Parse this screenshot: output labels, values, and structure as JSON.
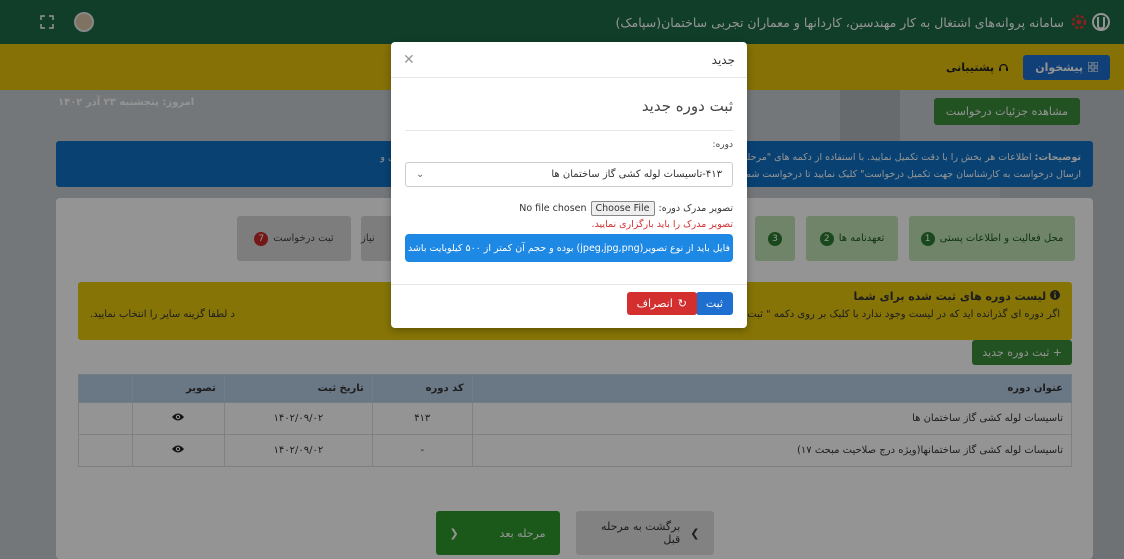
{
  "header": {
    "title": "سامانه پروانه‌های اشتغال به کار مهندسین، کاردانها و معماران تجربی ساختمان(سپامک)"
  },
  "navbar": {
    "dashboard": "پیشخوان",
    "support": "پشتیبانی"
  },
  "page": {
    "today": "امروز: پنجشنبه ۲۳ آذر ۱۴۰۲",
    "details_button": "مشاهده جزئیات درخواست",
    "info_bold": "توضیحات:",
    "info_line1": "اطلاعات هر بخش را با دقت تکمیل نمایید. با استفاده از دکمه های \"مرحله بعد\" که باید تمامی بخشها را تکمیل کرده و سپس در بخش پایانی بر روی دکمه \"ثبت نهایی و",
    "info_line2": "ارسال درخواست به کارشناسان جهت تکمیل درخواست\" کلیک نمایید تا درخواست شما به"
  },
  "steps": [
    {
      "num": "1",
      "label": "محل فعالیت و اطلاعات پستی",
      "state": "done"
    },
    {
      "num": "2",
      "label": "تعهدنامه ها",
      "state": "done"
    },
    {
      "num": "3",
      "label": "",
      "state": "done"
    },
    {
      "num": "",
      "label": "نیاز",
      "state": "pending"
    },
    {
      "num": "7",
      "label": "ثبت درخواست",
      "state": "pending"
    }
  ],
  "course_list": {
    "title": "لیست دوره های ثبت شده برای شما",
    "note_right": "اگر دوره ای گذرانده اید که در لیست وجود ندارد با کلیک بر روی دکمه \" ثبت دوره ج",
    "note_left": "د لطفا گزینه سایر را انتخاب نمایید."
  },
  "add_button": "ثبت دوره جدید",
  "table": {
    "headers": [
      "عنوان دوره",
      "کد دوره",
      "تاریخ ثبت",
      "تصویر"
    ],
    "rows": [
      {
        "title": "تاسیسات لوله کشی گاز ساختمان ها",
        "code": "۴۱۳",
        "date": "۱۴۰۲/۰۹/۰۲"
      },
      {
        "title": "تاسیسات لوله کشی گاز ساختمانها(ویژه درج صلاحیت مبحث ۱۷)",
        "code": "-",
        "date": "۱۴۰۲/۰۹/۰۲"
      }
    ]
  },
  "footer": {
    "prev": "برگشت به مرحله قبل",
    "next": "مرحله بعد"
  },
  "modal": {
    "header": "جدید",
    "title": "ثبت دوره جدید",
    "course_label": "دوره:",
    "course_value": "۴۱۳-تاسیسات لوله کشی گاز ساختمان ها",
    "file_label": "تصویر مدرک دوره:",
    "choose_file": "Choose File",
    "no_file": "No file chosen",
    "file_error": "تصویر مدرک را باید بارگزاری نمایید.",
    "file_info": "فایل باید از نوع تصویر(jpeg,jpg,png) بوده و حجم آن کمتر از ۵۰۰ کیلوبایت باشد",
    "submit": "ثبت",
    "cancel": "انصراف"
  },
  "colors": {
    "header_green": "#1c6b47",
    "nav_yellow": "#e6c30b",
    "primary_blue": "#1e6fcf",
    "danger_red": "#d32f2f",
    "success_green": "#2e9a2e"
  }
}
